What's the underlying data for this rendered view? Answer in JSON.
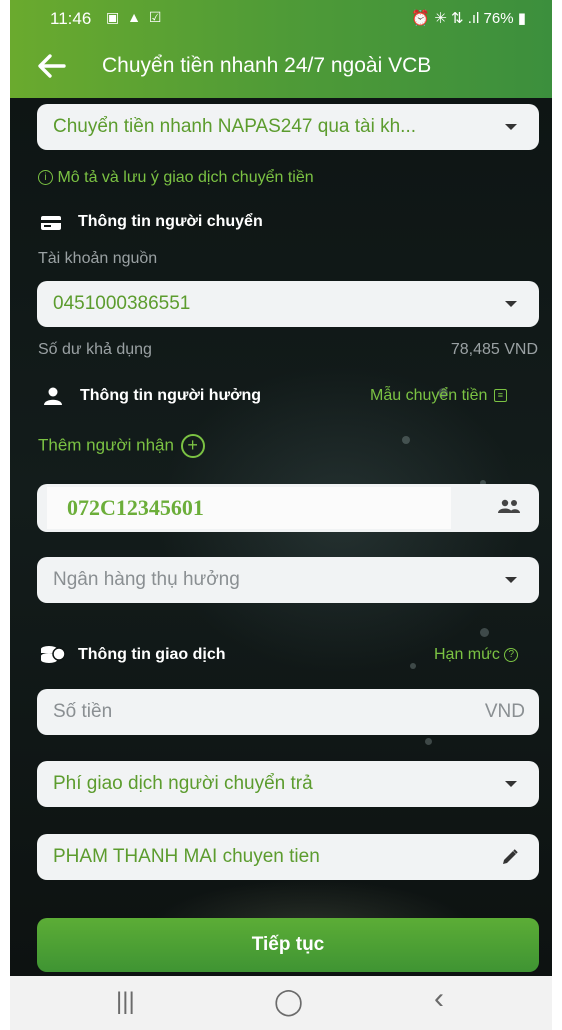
{
  "status_bar": {
    "time": "11:46",
    "left_icons": "▣ ▲ ☑",
    "right_icons": "⏰ ✳ ⇅ .ıl",
    "battery": "76%"
  },
  "header": {
    "title": "Chuyển tiền nhanh 24/7 ngoài VCB"
  },
  "transfer_method": {
    "value": "Chuyển tiền nhanh NAPAS247 qua tài kh..."
  },
  "description_link": "Mô tả và lưu ý giao dịch chuyển tiền",
  "sender": {
    "section_title": "Thông tin người chuyển",
    "source_account_label": "Tài khoản nguồn",
    "source_account_value": "0451000386551",
    "balance_label": "Số dư khả dụng",
    "balance_value": "78,485 VND"
  },
  "beneficiary": {
    "section_title": "Thông tin người hưởng",
    "template_link": "Mẫu chuyển tiền",
    "add_receiver": "Thêm người nhận",
    "account_number": "072C12345601",
    "bank_placeholder": "Ngân hàng thụ hưởng"
  },
  "transaction": {
    "section_title": "Thông tin giao dịch",
    "limit_link": "Hạn mức",
    "amount_placeholder": "Số tiền",
    "currency": "VND",
    "fee_option": "Phí giao dịch người chuyển trả",
    "content": "PHAM THANH MAI chuyen tien"
  },
  "continue_button": "Tiếp tục",
  "nav": {
    "recents": "|||",
    "home": "◯",
    "back": "‹"
  },
  "colors": {
    "accent_green": "#5c9c2e",
    "header_green": "#4f9b37",
    "background_dark": "#0f1514"
  }
}
